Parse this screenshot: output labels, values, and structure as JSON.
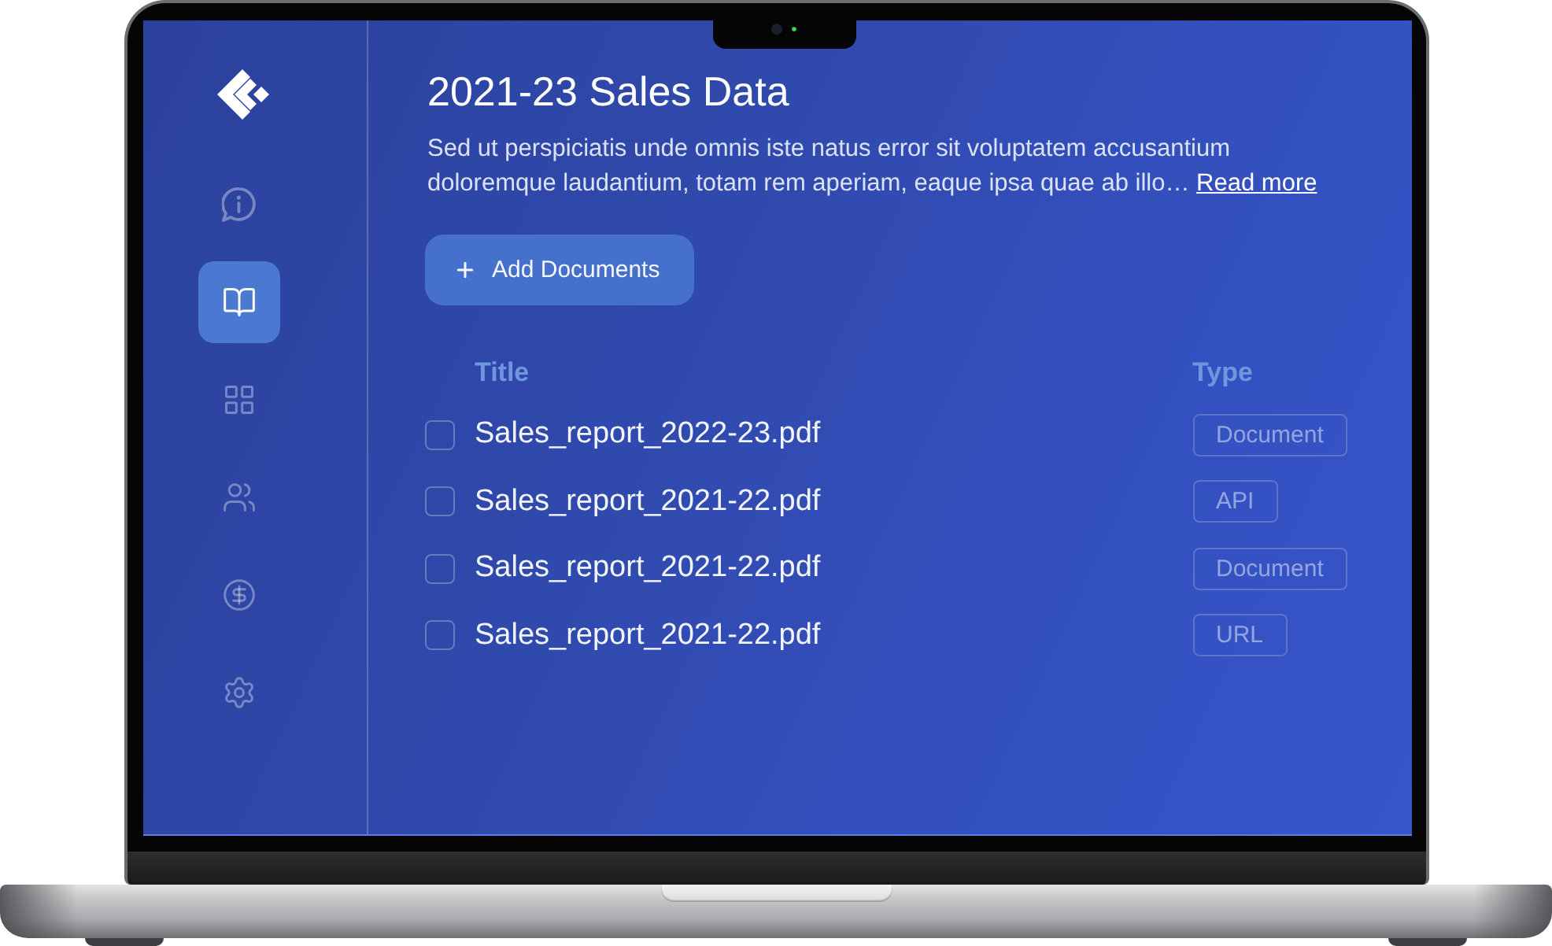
{
  "sidebar": {
    "items": [
      {
        "selected": false
      },
      {
        "selected": true
      },
      {
        "selected": false
      },
      {
        "selected": false
      },
      {
        "selected": false
      },
      {
        "selected": false
      }
    ]
  },
  "header": {
    "title": "2021-23 Sales Data",
    "description": "Sed ut perspiciatis unde omnis iste natus error sit voluptatem accusantium doloremque laudantium, totam rem aperiam, eaque ipsa quae ab illo…",
    "read_more": "Read more"
  },
  "add_button": {
    "label": "Add Documents"
  },
  "table": {
    "columns": [
      "Title",
      "Type"
    ],
    "rows": [
      {
        "checked": false,
        "title": "Sales_report_2022-23.pdf",
        "type": "Document"
      },
      {
        "checked": false,
        "title": "Sales_report_2021-22.pdf",
        "type": "API"
      },
      {
        "checked": false,
        "title": "Sales_report_2021-22.pdf",
        "type": "Document"
      },
      {
        "checked": false,
        "title": "Sales_report_2021-22.pdf",
        "type": "URL"
      }
    ]
  }
}
